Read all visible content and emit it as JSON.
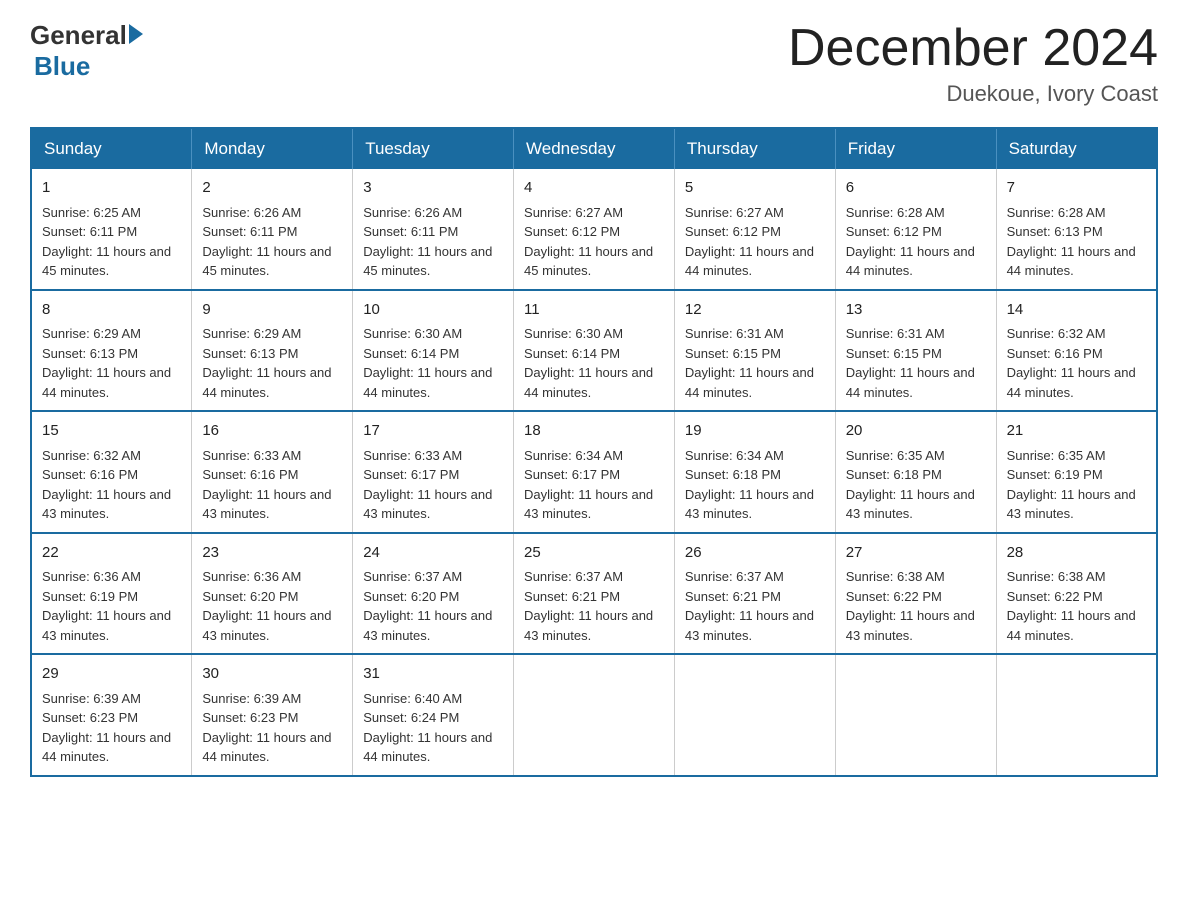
{
  "logo": {
    "text_general": "General",
    "text_blue": "Blue"
  },
  "title": {
    "month_year": "December 2024",
    "location": "Duekoue, Ivory Coast"
  },
  "weekdays": [
    "Sunday",
    "Monday",
    "Tuesday",
    "Wednesday",
    "Thursday",
    "Friday",
    "Saturday"
  ],
  "weeks": [
    [
      {
        "day": "1",
        "sunrise": "6:25 AM",
        "sunset": "6:11 PM",
        "daylight": "11 hours and 45 minutes."
      },
      {
        "day": "2",
        "sunrise": "6:26 AM",
        "sunset": "6:11 PM",
        "daylight": "11 hours and 45 minutes."
      },
      {
        "day": "3",
        "sunrise": "6:26 AM",
        "sunset": "6:11 PM",
        "daylight": "11 hours and 45 minutes."
      },
      {
        "day": "4",
        "sunrise": "6:27 AM",
        "sunset": "6:12 PM",
        "daylight": "11 hours and 45 minutes."
      },
      {
        "day": "5",
        "sunrise": "6:27 AM",
        "sunset": "6:12 PM",
        "daylight": "11 hours and 44 minutes."
      },
      {
        "day": "6",
        "sunrise": "6:28 AM",
        "sunset": "6:12 PM",
        "daylight": "11 hours and 44 minutes."
      },
      {
        "day": "7",
        "sunrise": "6:28 AM",
        "sunset": "6:13 PM",
        "daylight": "11 hours and 44 minutes."
      }
    ],
    [
      {
        "day": "8",
        "sunrise": "6:29 AM",
        "sunset": "6:13 PM",
        "daylight": "11 hours and 44 minutes."
      },
      {
        "day": "9",
        "sunrise": "6:29 AM",
        "sunset": "6:13 PM",
        "daylight": "11 hours and 44 minutes."
      },
      {
        "day": "10",
        "sunrise": "6:30 AM",
        "sunset": "6:14 PM",
        "daylight": "11 hours and 44 minutes."
      },
      {
        "day": "11",
        "sunrise": "6:30 AM",
        "sunset": "6:14 PM",
        "daylight": "11 hours and 44 minutes."
      },
      {
        "day": "12",
        "sunrise": "6:31 AM",
        "sunset": "6:15 PM",
        "daylight": "11 hours and 44 minutes."
      },
      {
        "day": "13",
        "sunrise": "6:31 AM",
        "sunset": "6:15 PM",
        "daylight": "11 hours and 44 minutes."
      },
      {
        "day": "14",
        "sunrise": "6:32 AM",
        "sunset": "6:16 PM",
        "daylight": "11 hours and 44 minutes."
      }
    ],
    [
      {
        "day": "15",
        "sunrise": "6:32 AM",
        "sunset": "6:16 PM",
        "daylight": "11 hours and 43 minutes."
      },
      {
        "day": "16",
        "sunrise": "6:33 AM",
        "sunset": "6:16 PM",
        "daylight": "11 hours and 43 minutes."
      },
      {
        "day": "17",
        "sunrise": "6:33 AM",
        "sunset": "6:17 PM",
        "daylight": "11 hours and 43 minutes."
      },
      {
        "day": "18",
        "sunrise": "6:34 AM",
        "sunset": "6:17 PM",
        "daylight": "11 hours and 43 minutes."
      },
      {
        "day": "19",
        "sunrise": "6:34 AM",
        "sunset": "6:18 PM",
        "daylight": "11 hours and 43 minutes."
      },
      {
        "day": "20",
        "sunrise": "6:35 AM",
        "sunset": "6:18 PM",
        "daylight": "11 hours and 43 minutes."
      },
      {
        "day": "21",
        "sunrise": "6:35 AM",
        "sunset": "6:19 PM",
        "daylight": "11 hours and 43 minutes."
      }
    ],
    [
      {
        "day": "22",
        "sunrise": "6:36 AM",
        "sunset": "6:19 PM",
        "daylight": "11 hours and 43 minutes."
      },
      {
        "day": "23",
        "sunrise": "6:36 AM",
        "sunset": "6:20 PM",
        "daylight": "11 hours and 43 minutes."
      },
      {
        "day": "24",
        "sunrise": "6:37 AM",
        "sunset": "6:20 PM",
        "daylight": "11 hours and 43 minutes."
      },
      {
        "day": "25",
        "sunrise": "6:37 AM",
        "sunset": "6:21 PM",
        "daylight": "11 hours and 43 minutes."
      },
      {
        "day": "26",
        "sunrise": "6:37 AM",
        "sunset": "6:21 PM",
        "daylight": "11 hours and 43 minutes."
      },
      {
        "day": "27",
        "sunrise": "6:38 AM",
        "sunset": "6:22 PM",
        "daylight": "11 hours and 43 minutes."
      },
      {
        "day": "28",
        "sunrise": "6:38 AM",
        "sunset": "6:22 PM",
        "daylight": "11 hours and 44 minutes."
      }
    ],
    [
      {
        "day": "29",
        "sunrise": "6:39 AM",
        "sunset": "6:23 PM",
        "daylight": "11 hours and 44 minutes."
      },
      {
        "day": "30",
        "sunrise": "6:39 AM",
        "sunset": "6:23 PM",
        "daylight": "11 hours and 44 minutes."
      },
      {
        "day": "31",
        "sunrise": "6:40 AM",
        "sunset": "6:24 PM",
        "daylight": "11 hours and 44 minutes."
      },
      null,
      null,
      null,
      null
    ]
  ]
}
